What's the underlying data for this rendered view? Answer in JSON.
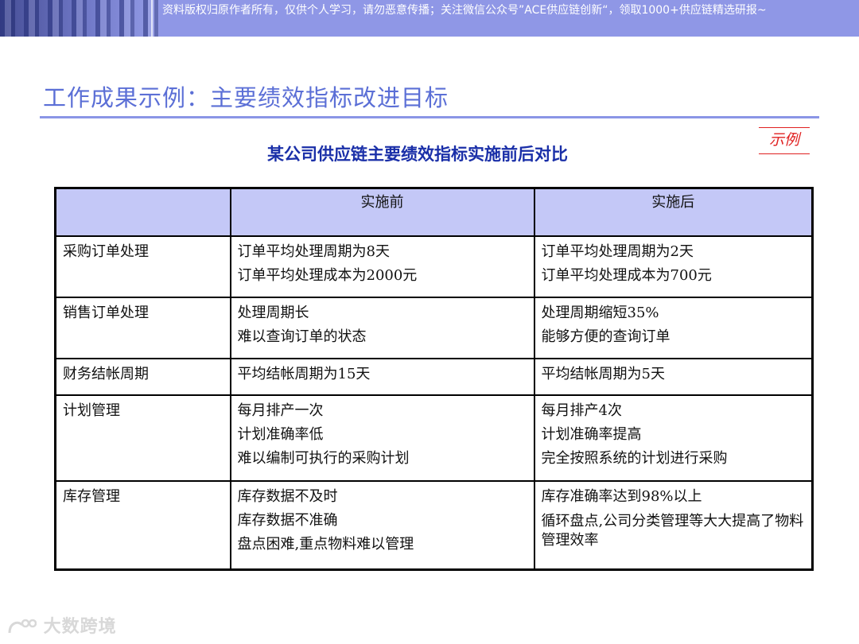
{
  "banner": {
    "text": "资料版权归原作者所有，仅供个人学习，请勿恶意传播；关注微信公众号”ACE供应链创新“，领取1000+供应链精选研报~"
  },
  "page": {
    "title": "工作成果示例：主要绩效指标改进目标",
    "example_tag": "示例",
    "subtitle": "某公司供应链主要绩效指标实施前后对比"
  },
  "table": {
    "headers": [
      "",
      "实施前",
      "实施后"
    ],
    "rows": [
      {
        "category": "采购订单处理",
        "before": [
          "订单平均处理周期为8天",
          "订单平均处理成本为2000元"
        ],
        "after": [
          "订单平均处理周期为2天",
          "订单平均处理成本为700元"
        ]
      },
      {
        "category": "销售订单处理",
        "before": [
          "处理周期长",
          "难以查询订单的状态"
        ],
        "after": [
          "处理周期缩短35%",
          "能够方便的查询订单"
        ]
      },
      {
        "category": "财务结帐周期",
        "before": [
          "平均结帐周期为15天"
        ],
        "after": [
          "平均结帐周期为5天"
        ]
      },
      {
        "category": "计划管理",
        "before": [
          "每月排产一次",
          "计划准确率低",
          "难以编制可执行的采购计划"
        ],
        "after": [
          "每月排产4次",
          "计划准确率提高",
          "完全按照系统的计划进行采购"
        ]
      },
      {
        "category": "库存管理",
        "before": [
          "库存数据不及时",
          "库存数据不准确",
          "盘点困难,重点物料难以管理"
        ],
        "after": [
          "库存准确率达到98%以上",
          "循环盘点,公司分类管理等大大提高了物料管理效率"
        ]
      }
    ]
  },
  "watermark": {
    "text": "大数跨境",
    "icon": "logo-icon"
  }
}
